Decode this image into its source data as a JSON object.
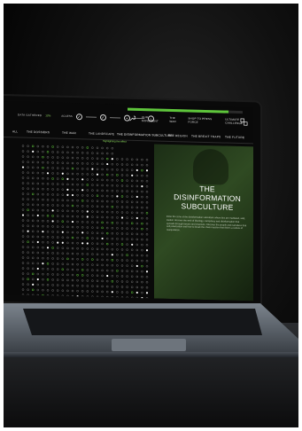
{
  "topbar": {
    "data_gathered_label": "DATA GATHERED",
    "data_gathered_value": "12%",
    "access_label": "ACCESS",
    "steps": [
      "",
      "",
      "",
      ""
    ],
    "progress": 0.88
  },
  "menu": {
    "items": [
      "OUR MOVEMENT",
      "THE WAR",
      "SHOP TO PRESS FORCE",
      "ULTIMATE CHALLENGE"
    ]
  },
  "tabs": {
    "items": [
      "ALL",
      "THE DOSSIERS",
      "THE WAR",
      "THE LANDSCAPE",
      "THE DISINFORMATION SUBCULTURE",
      "THE REGION",
      "THE BREXIT TRAPS",
      "THE FUTURE"
    ],
    "active_index": 4,
    "sub_label": "Highlighting the effect"
  },
  "panel": {
    "title": "THE DISINFORMATION SUBCULTURE",
    "body": "Enter the zone of the disinformation subculture where lies are marketed, sold, traded. Uncover the web of ideology, conspiracy and disinformation that spreads through forums and channels. Discover the people and narratives that sell polarisation and how to break the chain reaction that drives a culture of manipulation."
  },
  "icons": {
    "tool": "wrench-icon",
    "share": "share-icon"
  },
  "colors": {
    "accent": "#5ec53b",
    "panel_green": "#2f4a22",
    "background": "#090909"
  }
}
